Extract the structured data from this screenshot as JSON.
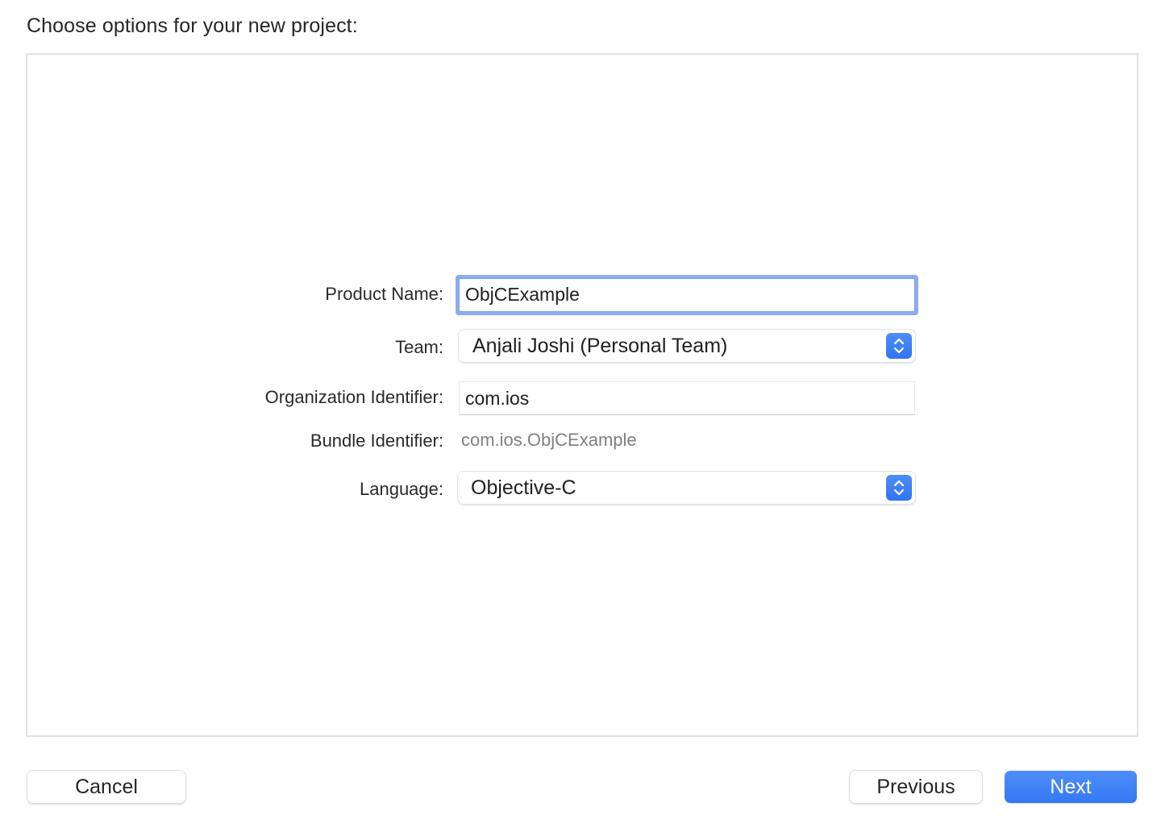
{
  "dialog": {
    "heading": "Choose options for your new project:"
  },
  "form": {
    "product_name": {
      "label": "Product Name:",
      "value": "ObjCExample"
    },
    "team": {
      "label": "Team:",
      "selected": "Anjali Joshi (Personal Team)",
      "icon": "up-down-chevron-icon"
    },
    "organization_identifier": {
      "label": "Organization Identifier:",
      "value": "com.ios"
    },
    "bundle_identifier": {
      "label": "Bundle Identifier:",
      "value": "com.ios.ObjCExample"
    },
    "language": {
      "label": "Language:",
      "selected": "Objective-C",
      "icon": "up-down-chevron-icon"
    }
  },
  "footer": {
    "cancel_label": "Cancel",
    "previous_label": "Previous",
    "next_label": "Next"
  },
  "colors": {
    "accent": "#3478f4",
    "focus_ring": "#8fadf0",
    "secondary_text": "#808080"
  }
}
